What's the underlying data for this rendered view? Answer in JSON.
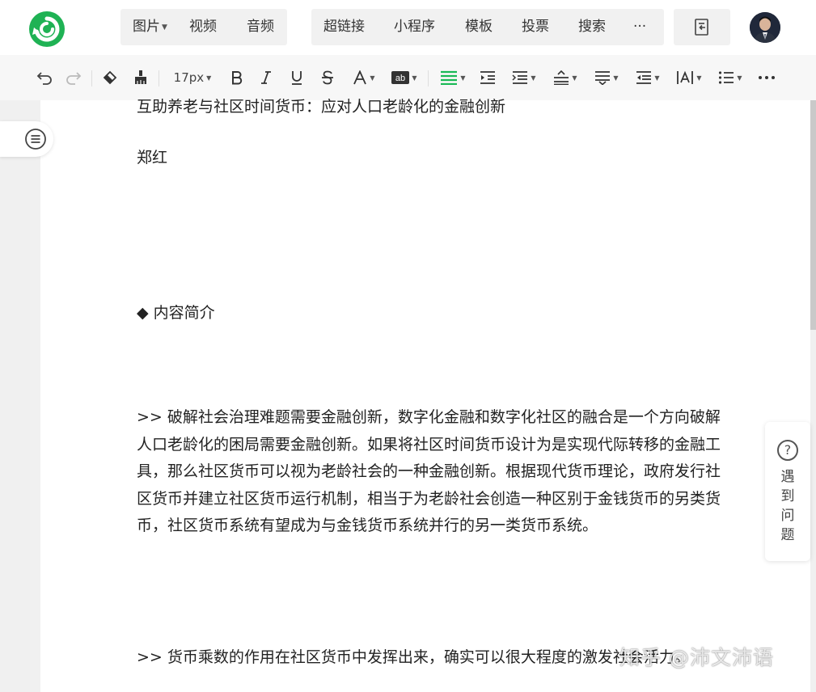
{
  "topbar": {
    "logo_icon": "zhihu-circle-logo-icon",
    "media_group": [
      {
        "label": "图片",
        "has_dropdown": true
      },
      {
        "label": "视频",
        "has_dropdown": false
      },
      {
        "label": "音频",
        "has_dropdown": false
      }
    ],
    "insert_group": [
      {
        "label": "超链接"
      },
      {
        "label": "小程序"
      },
      {
        "label": "模板"
      },
      {
        "label": "投票"
      },
      {
        "label": "搜索"
      },
      {
        "label": "···"
      }
    ],
    "draft_icon": "draft-document-icon",
    "avatar_icon": "user-avatar"
  },
  "toolbar": {
    "font_size": "17px",
    "icons": [
      "undo-icon",
      "redo-icon",
      "clear-format-icon",
      "format-painter-icon",
      "font-size-dropdown",
      "bold-icon",
      "italic-icon",
      "underline-icon",
      "strikethrough-icon",
      "font-color-icon",
      "highlight-icon",
      "align-icon",
      "indent-icon",
      "paragraph-spacing-icon",
      "line-height-icon",
      "text-align-icon",
      "outdent-icon",
      "letter-spacing-icon",
      "list-icon",
      "more-icon"
    ],
    "accent": "#19b955"
  },
  "document": {
    "title": "互助养老与社区时间货币：应对人口老龄化的金融创新",
    "author": "郑红",
    "section_heading": "◆ 内容简介",
    "paragraph_1": ">> 破解社会治理难题需要金融创新，数字化金融和数字化社区的融合是一个方向破解人口老龄化的困局需要金融创新。如果将社区时间货币设计为是实现代际转移的金融工具，那么社区货币可以视为老龄社会的一种金融创新。根据现代货币理论，政府发行社区货币并建立社区货币运行机制，相当于为老龄社会创造一种区别于金钱货币的另类货币，社区货币系统有望成为与金钱货币系统并行的另一类货币系统。",
    "paragraph_2": ">> 货币乘数的作用在社区货币中发挥出来，确实可以很大程度的激发社会活力。"
  },
  "help_widget": {
    "icon": "question-circle-icon",
    "label": "遇到问题"
  },
  "watermark": "知乎 @沛文沛语"
}
